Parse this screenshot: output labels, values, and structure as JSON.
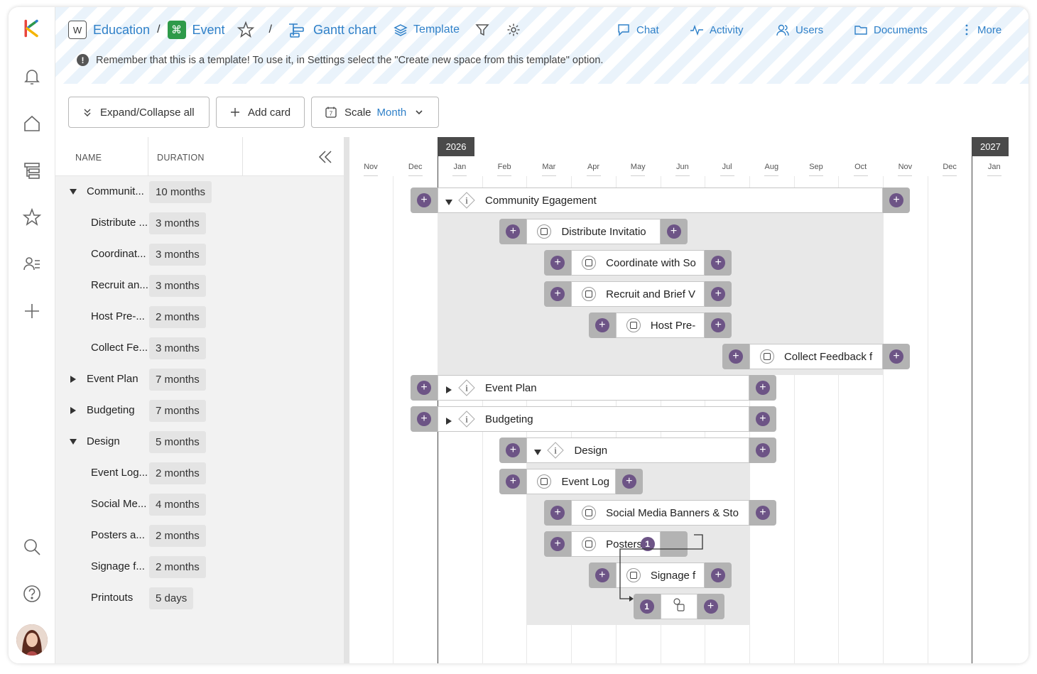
{
  "breadcrumb": {
    "workspace_badge": "W",
    "workspace": "Education",
    "space": "Event",
    "view": "Gantt chart",
    "template": "Template"
  },
  "nav": {
    "chat": "Chat",
    "activity": "Activity",
    "users": "Users",
    "documents": "Documents",
    "more": "More"
  },
  "notice": "Remember that this is a template! To use it, in Settings select the \"Create new space from this template\" option.",
  "toolbar": {
    "expand_collapse": "Expand/Collapse all",
    "add_card": "Add card",
    "scale_label": "Scale",
    "scale_value": "Month"
  },
  "left_panel": {
    "col_name": "NAME",
    "col_duration": "DURATION",
    "rows": [
      {
        "name": "Communit...",
        "duration": "10 months",
        "level": 0,
        "toggle": "open"
      },
      {
        "name": "Distribute ...",
        "duration": "3 months",
        "level": 1,
        "toggle": "none"
      },
      {
        "name": "Coordinat...",
        "duration": "3 months",
        "level": 1,
        "toggle": "none"
      },
      {
        "name": "Recruit an...",
        "duration": "3 months",
        "level": 1,
        "toggle": "none"
      },
      {
        "name": "Host Pre-...",
        "duration": "2 months",
        "level": 1,
        "toggle": "none"
      },
      {
        "name": "Collect Fe...",
        "duration": "3 months",
        "level": 1,
        "toggle": "none"
      },
      {
        "name": "Event Plan",
        "duration": "7 months",
        "level": 0,
        "toggle": "closed"
      },
      {
        "name": "Budgeting",
        "duration": "7 months",
        "level": 0,
        "toggle": "closed"
      },
      {
        "name": "Design",
        "duration": "5 months",
        "level": 0,
        "toggle": "open"
      },
      {
        "name": "Event Log...",
        "duration": "2 months",
        "level": 1,
        "toggle": "none"
      },
      {
        "name": "Social Me...",
        "duration": "4 months",
        "level": 1,
        "toggle": "none"
      },
      {
        "name": "Posters a...",
        "duration": "2 months",
        "level": 1,
        "toggle": "none"
      },
      {
        "name": "Signage f...",
        "duration": "2 months",
        "level": 1,
        "toggle": "none"
      },
      {
        "name": "Printouts",
        "duration": "5 days",
        "level": 1,
        "toggle": "none"
      }
    ]
  },
  "timeline": {
    "years": [
      "2026",
      "2027"
    ],
    "months": [
      "Nov",
      "Dec",
      "Jan",
      "Feb",
      "Mar",
      "Apr",
      "May",
      "Jun",
      "Jul",
      "Aug",
      "Sep",
      "Oct",
      "Nov",
      "Dec",
      "Jan"
    ]
  },
  "bars": [
    {
      "label": "Community Egagement",
      "start": 2,
      "months": 10,
      "kind": "group",
      "toggle": "open"
    },
    {
      "label": "Distribute Invitatio",
      "start": 4,
      "months": 3,
      "kind": "task"
    },
    {
      "label": "Coordinate with So",
      "start": 5,
      "months": 3,
      "kind": "task"
    },
    {
      "label": "Recruit and Brief V",
      "start": 5,
      "months": 3,
      "kind": "task"
    },
    {
      "label": "Host Pre-",
      "start": 6,
      "months": 2,
      "kind": "task"
    },
    {
      "label": "Collect Feedback f",
      "start": 9,
      "months": 3,
      "kind": "task"
    },
    {
      "label": "Event Plan",
      "start": 2,
      "months": 7,
      "kind": "group",
      "toggle": "closed"
    },
    {
      "label": "Budgeting",
      "start": 2,
      "months": 7,
      "kind": "group",
      "toggle": "closed"
    },
    {
      "label": "Design",
      "start": 4,
      "months": 5,
      "kind": "group",
      "toggle": "open"
    },
    {
      "label": "Event Log",
      "start": 4,
      "months": 2,
      "kind": "task"
    },
    {
      "label": "Social Media Banners & Sto",
      "start": 5,
      "months": 4,
      "kind": "task"
    },
    {
      "label": "Posters a",
      "start": 5,
      "months": 2,
      "kind": "task",
      "dep_count": "1"
    },
    {
      "label": "Signage f",
      "start": 6,
      "months": 2,
      "kind": "task"
    },
    {
      "label": "",
      "start": 7,
      "months": 0.2,
      "kind": "milestone",
      "dep_count": "1"
    }
  ]
}
